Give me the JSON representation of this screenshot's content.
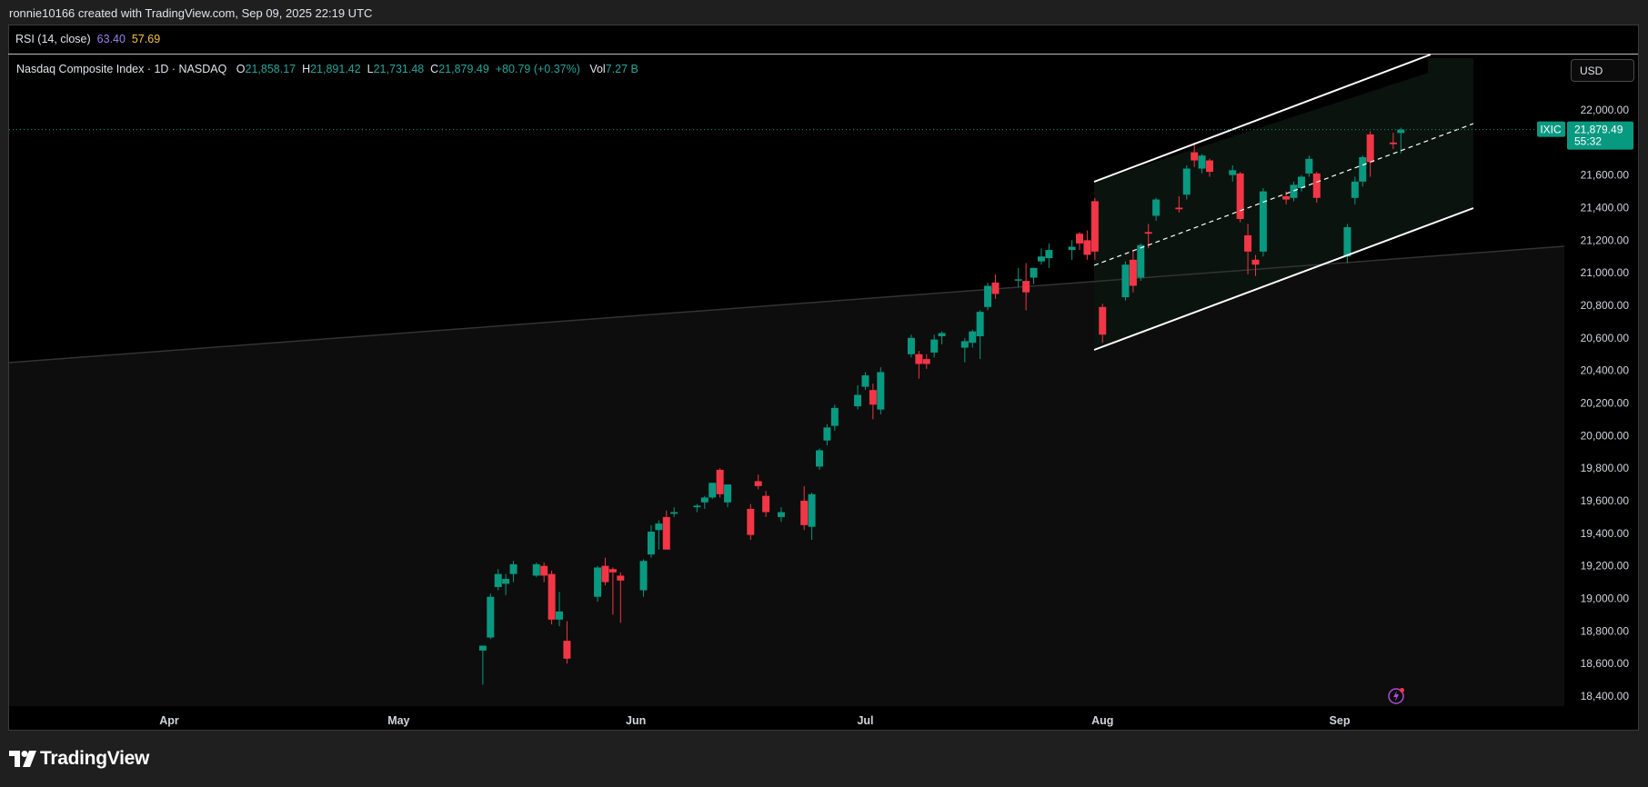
{
  "header": {
    "credit": "ronnie10166 created with TradingView.com, Sep 09, 2025 22:19 UTC"
  },
  "rsi": {
    "label": "RSI (14, close)",
    "value1": "63.40",
    "value2": "57.69"
  },
  "legend": {
    "title": "Nasdaq Composite Index · 1D · NASDAQ",
    "o_key": "O",
    "o_val": "21,858.17",
    "h_key": "H",
    "h_val": "21,891.42",
    "l_key": "L",
    "l_val": "21,731.48",
    "c_key": "C",
    "c_val": "21,879.49",
    "change": "+80.79 (+0.37%)",
    "vol_key": "Vol",
    "vol_val": "7.27 B"
  },
  "currency_button": "USD",
  "price_tag": {
    "symbol": "IXIC",
    "price": "21,879.49",
    "countdown": "55:32"
  },
  "footer": {
    "brand": "TradingView"
  },
  "colors": {
    "up": "#089981",
    "down": "#f23645",
    "background": "#000000",
    "channel_fill": "#0b130e"
  },
  "chart_data": {
    "type": "candlestick",
    "y_axis": {
      "min": 18400,
      "max": 22000,
      "ticks": [
        "18,400.00",
        "18,600.00",
        "18,800.00",
        "19,000.00",
        "19,200.00",
        "19,400.00",
        "19,600.00",
        "19,800.00",
        "20,000.00",
        "20,200.00",
        "20,400.00",
        "20,600.00",
        "20,800.00",
        "21,000.00",
        "21,200.00",
        "21,400.00",
        "21,600.00",
        "21,800.00",
        "22,000.00"
      ]
    },
    "x_axis": {
      "labels": [
        {
          "label": "Apr",
          "date": "2025-04-01"
        },
        {
          "label": "May",
          "date": "2025-05-01"
        },
        {
          "label": "Jun",
          "date": "2025-06-01"
        },
        {
          "label": "Jul",
          "date": "2025-07-01"
        },
        {
          "label": "Aug",
          "date": "2025-08-01"
        },
        {
          "label": "Sep",
          "date": "2025-09-01"
        }
      ]
    },
    "candles": [
      {
        "date": "2025-05-12",
        "o": 18680,
        "h": 18710,
        "l": 18470,
        "c": 18710
      },
      {
        "date": "2025-05-13",
        "o": 18760,
        "h": 19030,
        "l": 18750,
        "c": 19010
      },
      {
        "date": "2025-05-14",
        "o": 19070,
        "h": 19180,
        "l": 19050,
        "c": 19150
      },
      {
        "date": "2025-05-15",
        "o": 19090,
        "h": 19150,
        "l": 19020,
        "c": 19120
      },
      {
        "date": "2025-05-16",
        "o": 19150,
        "h": 19230,
        "l": 19100,
        "c": 19210
      },
      {
        "date": "2025-05-19",
        "o": 19140,
        "h": 19220,
        "l": 19130,
        "c": 19210
      },
      {
        "date": "2025-05-20",
        "o": 19200,
        "h": 19220,
        "l": 19100,
        "c": 19140
      },
      {
        "date": "2025-05-21",
        "o": 19150,
        "h": 19170,
        "l": 18840,
        "c": 18870
      },
      {
        "date": "2025-05-22",
        "o": 18870,
        "h": 19040,
        "l": 18830,
        "c": 18920
      },
      {
        "date": "2025-05-23",
        "o": 18740,
        "h": 18860,
        "l": 18600,
        "c": 18630
      },
      {
        "date": "2025-05-27",
        "o": 19010,
        "h": 19200,
        "l": 18980,
        "c": 19190
      },
      {
        "date": "2025-05-28",
        "o": 19200,
        "h": 19250,
        "l": 19080,
        "c": 19100
      },
      {
        "date": "2025-05-29",
        "o": 19180,
        "h": 19190,
        "l": 18900,
        "c": 19160
      },
      {
        "date": "2025-05-30",
        "o": 19140,
        "h": 19160,
        "l": 18850,
        "c": 19110
      },
      {
        "date": "2025-06-02",
        "o": 19050,
        "h": 19240,
        "l": 19010,
        "c": 19230
      },
      {
        "date": "2025-06-03",
        "o": 19270,
        "h": 19450,
        "l": 19250,
        "c": 19410
      },
      {
        "date": "2025-06-04",
        "o": 19420,
        "h": 19480,
        "l": 19300,
        "c": 19460
      },
      {
        "date": "2025-06-05",
        "o": 19500,
        "h": 19540,
        "l": 19360,
        "c": 19300
      },
      {
        "date": "2025-06-06",
        "o": 19520,
        "h": 19560,
        "l": 19500,
        "c": 19530
      },
      {
        "date": "2025-06-09",
        "o": 19560,
        "h": 19580,
        "l": 19530,
        "c": 19570
      },
      {
        "date": "2025-06-10",
        "o": 19590,
        "h": 19630,
        "l": 19550,
        "c": 19620
      },
      {
        "date": "2025-06-11",
        "o": 19620,
        "h": 19680,
        "l": 19610,
        "c": 19710
      },
      {
        "date": "2025-06-12",
        "o": 19790,
        "h": 19800,
        "l": 19620,
        "c": 19640
      },
      {
        "date": "2025-06-13",
        "o": 19590,
        "h": 19680,
        "l": 19560,
        "c": 19700
      },
      {
        "date": "2025-06-16",
        "o": 19550,
        "h": 19580,
        "l": 19360,
        "c": 19390
      },
      {
        "date": "2025-06-17",
        "o": 19720,
        "h": 19760,
        "l": 19670,
        "c": 19690
      },
      {
        "date": "2025-06-18",
        "o": 19630,
        "h": 19660,
        "l": 19500,
        "c": 19530
      },
      {
        "date": "2025-06-20",
        "o": 19500,
        "h": 19560,
        "l": 19470,
        "c": 19530
      },
      {
        "date": "2025-06-23",
        "o": 19600,
        "h": 19690,
        "l": 19420,
        "c": 19450
      },
      {
        "date": "2025-06-24",
        "o": 19440,
        "h": 19650,
        "l": 19360,
        "c": 19640
      },
      {
        "date": "2025-06-25",
        "o": 19810,
        "h": 19920,
        "l": 19790,
        "c": 19910
      },
      {
        "date": "2025-06-26",
        "o": 19970,
        "h": 20070,
        "l": 19940,
        "c": 20050
      },
      {
        "date": "2025-06-27",
        "o": 20060,
        "h": 20190,
        "l": 20030,
        "c": 20170
      },
      {
        "date": "2025-06-30",
        "o": 20180,
        "h": 20310,
        "l": 20160,
        "c": 20250
      },
      {
        "date": "2025-07-01",
        "o": 20300,
        "h": 20390,
        "l": 20280,
        "c": 20370
      },
      {
        "date": "2025-07-02",
        "o": 20280,
        "h": 20320,
        "l": 20100,
        "c": 20190
      },
      {
        "date": "2025-07-03",
        "o": 20160,
        "h": 20420,
        "l": 20130,
        "c": 20390
      },
      {
        "date": "2025-07-07",
        "o": 20500,
        "h": 20620,
        "l": 20480,
        "c": 20600
      },
      {
        "date": "2025-07-08",
        "o": 20500,
        "h": 20520,
        "l": 20350,
        "c": 20440
      },
      {
        "date": "2025-07-09",
        "o": 20470,
        "h": 20500,
        "l": 20410,
        "c": 20440
      },
      {
        "date": "2025-07-10",
        "o": 20510,
        "h": 20620,
        "l": 20480,
        "c": 20590
      },
      {
        "date": "2025-07-11",
        "o": 20610,
        "h": 20640,
        "l": 20560,
        "c": 20630
      },
      {
        "date": "2025-07-14",
        "o": 20540,
        "h": 20600,
        "l": 20450,
        "c": 20580
      },
      {
        "date": "2025-07-15",
        "o": 20570,
        "h": 20650,
        "l": 20540,
        "c": 20640
      },
      {
        "date": "2025-07-16",
        "o": 20610,
        "h": 20770,
        "l": 20470,
        "c": 20760
      },
      {
        "date": "2025-07-17",
        "o": 20790,
        "h": 20940,
        "l": 20770,
        "c": 20920
      },
      {
        "date": "2025-07-18",
        "o": 20940,
        "h": 20990,
        "l": 20840,
        "c": 20870
      },
      {
        "date": "2025-07-21",
        "o": 20960,
        "h": 21030,
        "l": 20910,
        "c": 20960
      },
      {
        "date": "2025-07-22",
        "o": 20950,
        "h": 21060,
        "l": 20770,
        "c": 20880
      },
      {
        "date": "2025-07-23",
        "o": 20970,
        "h": 21030,
        "l": 20930,
        "c": 21030
      },
      {
        "date": "2025-07-24",
        "o": 21070,
        "h": 21150,
        "l": 21050,
        "c": 21100
      },
      {
        "date": "2025-07-25",
        "o": 21090,
        "h": 21180,
        "l": 21030,
        "c": 21140
      },
      {
        "date": "2025-07-28",
        "o": 21140,
        "h": 21200,
        "l": 21080,
        "c": 21160
      },
      {
        "date": "2025-07-29",
        "o": 21240,
        "h": 21250,
        "l": 21140,
        "c": 21180
      },
      {
        "date": "2025-07-30",
        "o": 21200,
        "h": 21260,
        "l": 21080,
        "c": 21110
      },
      {
        "date": "2025-07-31",
        "o": 21440,
        "h": 21460,
        "l": 21080,
        "c": 21130
      },
      {
        "date": "2025-08-01",
        "o": 20790,
        "h": 20810,
        "l": 20570,
        "c": 20620
      },
      {
        "date": "2025-08-04",
        "o": 20850,
        "h": 21070,
        "l": 20830,
        "c": 21050
      },
      {
        "date": "2025-08-05",
        "o": 21080,
        "h": 21140,
        "l": 20880,
        "c": 20920
      },
      {
        "date": "2025-08-06",
        "o": 20970,
        "h": 21180,
        "l": 20950,
        "c": 21170
      },
      {
        "date": "2025-08-07",
        "o": 21250,
        "h": 21300,
        "l": 21150,
        "c": 21240
      },
      {
        "date": "2025-08-08",
        "o": 21350,
        "h": 21460,
        "l": 21320,
        "c": 21450
      },
      {
        "date": "2025-08-11",
        "o": 21400,
        "h": 21470,
        "l": 21370,
        "c": 21390
      },
      {
        "date": "2025-08-12",
        "o": 21480,
        "h": 21660,
        "l": 21450,
        "c": 21640
      },
      {
        "date": "2025-08-13",
        "o": 21740,
        "h": 21800,
        "l": 21650,
        "c": 21690
      },
      {
        "date": "2025-08-14",
        "o": 21640,
        "h": 21730,
        "l": 21610,
        "c": 21720
      },
      {
        "date": "2025-08-15",
        "o": 21690,
        "h": 21700,
        "l": 21590,
        "c": 21620
      },
      {
        "date": "2025-08-18",
        "o": 21600,
        "h": 21660,
        "l": 21560,
        "c": 21630
      },
      {
        "date": "2025-08-19",
        "o": 21610,
        "h": 21620,
        "l": 21310,
        "c": 21330
      },
      {
        "date": "2025-08-20",
        "o": 21230,
        "h": 21300,
        "l": 20990,
        "c": 21130
      },
      {
        "date": "2025-08-21",
        "o": 21080,
        "h": 21110,
        "l": 20980,
        "c": 21050
      },
      {
        "date": "2025-08-22",
        "o": 21130,
        "h": 21520,
        "l": 21100,
        "c": 21500
      },
      {
        "date": "2025-08-25",
        "o": 21470,
        "h": 21500,
        "l": 21420,
        "c": 21450
      },
      {
        "date": "2025-08-26",
        "o": 21460,
        "h": 21560,
        "l": 21440,
        "c": 21540
      },
      {
        "date": "2025-08-27",
        "o": 21520,
        "h": 21600,
        "l": 21500,
        "c": 21590
      },
      {
        "date": "2025-08-28",
        "o": 21610,
        "h": 21720,
        "l": 21590,
        "c": 21700
      },
      {
        "date": "2025-08-29",
        "o": 21610,
        "h": 21620,
        "l": 21430,
        "c": 21460
      },
      {
        "date": "2025-09-02",
        "o": 21100,
        "h": 21300,
        "l": 21060,
        "c": 21280
      },
      {
        "date": "2025-09-03",
        "o": 21460,
        "h": 21590,
        "l": 21420,
        "c": 21560
      },
      {
        "date": "2025-09-04",
        "o": 21560,
        "h": 21720,
        "l": 21530,
        "c": 21710
      },
      {
        "date": "2025-09-05",
        "o": 21850,
        "h": 21870,
        "l": 21590,
        "c": 21680
      },
      {
        "date": "2025-09-08",
        "o": 21800,
        "h": 21860,
        "l": 21760,
        "c": 21790
      },
      {
        "date": "2025-09-09",
        "o": 21858.17,
        "h": 21891.42,
        "l": 21731.48,
        "c": 21879.49
      }
    ],
    "last_price": 21879.49
  }
}
